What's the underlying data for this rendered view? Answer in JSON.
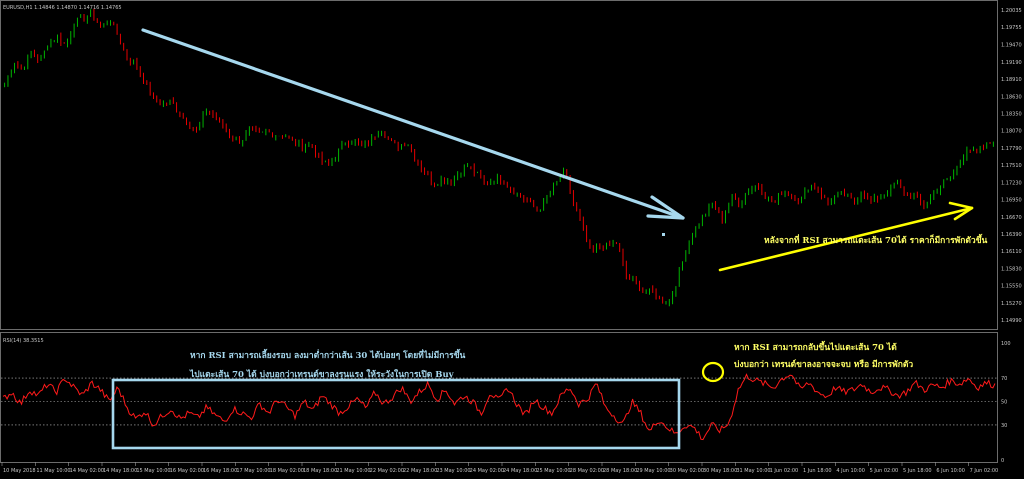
{
  "main_pane": {
    "header": "EURUSD,H1  1.14846 1.14870 1.14716 1.14765",
    "price_labels": [
      "1.20035",
      "1.19755",
      "1.19470",
      "1.19190",
      "1.18910",
      "1.18630",
      "1.18350",
      "1.18070",
      "1.17790",
      "1.17510",
      "1.17230",
      "1.16950",
      "1.16670",
      "1.16390",
      "1.16110",
      "1.15830",
      "1.15550",
      "1.15270",
      "1.14990"
    ]
  },
  "rsi_pane": {
    "header": "RSI(14) 38.3515",
    "level_labels": [
      "100",
      "70",
      "50",
      "30",
      "0"
    ]
  },
  "time_axis": {
    "labels": [
      "10 May 2018",
      "11 May 10:00",
      "14 May 02:00",
      "14 May 18:00",
      "15 May 10:00",
      "16 May 02:00",
      "16 May 18:00",
      "17 May 10:00",
      "18 May 02:00",
      "18 May 18:00",
      "21 May 10:00",
      "22 May 02:00",
      "22 May 18:00",
      "23 May 10:00",
      "24 May 02:00",
      "24 May 18:00",
      "25 May 10:00",
      "28 May 02:00",
      "28 May 18:00",
      "29 May 10:00",
      "30 May 02:00",
      "30 May 18:00",
      "31 May 10:00",
      "1 Jun 02:00",
      "1 Jun 18:00",
      "4 Jun 10:00",
      "5 Jun 02:00",
      "5 Jun 18:00",
      "6 Jun 10:00",
      "7 Jun 02:00"
    ]
  },
  "annotations": {
    "uptrend_note": "หลังจากที่ RSI สามารถแตะเส้น 70ได้ ราคาก็มีการพักตัวขึ้น",
    "rsi_box_line1": "หาก RSI สามารถเลี้ยงรอบ ลงมาต่ำกว่าเส้น 30 ได้บ่อยๆ โดยที่ไม่มีการขึ้น",
    "rsi_box_line2": "ไปแตะเส้น 70 ได้ บ่งบอกว่าเทรนด์ขาลงรุนแรง ให้ระวังในการเปิด Buy",
    "rsi_right_line1": "หาก RSI สามารถกลับขึ้นไปแตะเส้น 70 ได้",
    "rsi_right_line2": "บ่งบอกว่า เทรนด์ขาลงอาจจะจบ หรือ มีการพักตัว"
  },
  "colors": {
    "background": "#000000",
    "bull_candle": "#00c800",
    "bear_candle": "#ff0000",
    "rsi_line": "#ff1a1a",
    "down_arrow": "#a6d8ee",
    "up_arrow": "#ffff00",
    "box": "#a6d8ee",
    "circle": "#ffff00",
    "text_cyan": "#a6d8ee",
    "text_yellow": "#ffff66"
  },
  "chart_data": {
    "type": "candlestick",
    "symbol": "EURUSD",
    "timeframe": "H1",
    "ylim": [
      1.1499,
      1.20035
    ],
    "close_path": [
      1.188,
      1.192,
      1.1905,
      1.1935,
      1.192,
      1.195,
      1.196,
      1.1945,
      1.1985,
      1.199,
      1.1998,
      1.1975,
      1.199,
      1.196,
      1.1925,
      1.1915,
      1.1885,
      1.186,
      1.185,
      1.1855,
      1.1835,
      1.182,
      1.1805,
      1.184,
      1.183,
      1.1815,
      1.1795,
      1.179,
      1.181,
      1.18,
      1.1805,
      1.18,
      1.18,
      1.179,
      1.178,
      1.1785,
      1.176,
      1.175,
      1.177,
      1.179,
      1.179,
      1.178,
      1.1795,
      1.181,
      1.179,
      1.178,
      1.179,
      1.176,
      1.174,
      1.172,
      1.173,
      1.1725,
      1.174,
      1.175,
      1.1735,
      1.172,
      1.173,
      1.1725,
      1.171,
      1.17,
      1.169,
      1.1675,
      1.17,
      1.172,
      1.174,
      1.169,
      1.165,
      1.161,
      1.162,
      1.162,
      1.1625,
      1.157,
      1.156,
      1.1545,
      1.1545,
      1.153,
      1.153,
      1.157,
      1.162,
      1.165,
      1.167,
      1.169,
      1.166,
      1.17,
      1.169,
      1.171,
      1.172,
      1.17,
      1.169,
      1.171,
      1.17,
      1.1695,
      1.172,
      1.171,
      1.169,
      1.17,
      1.1705,
      1.169,
      1.171,
      1.169,
      1.17,
      1.171,
      1.1725,
      1.17,
      1.17,
      1.1685,
      1.17,
      1.172,
      1.173,
      1.175,
      1.178,
      1.177,
      1.178,
      1.179
    ],
    "rsi_levels": [
      30,
      50,
      70
    ],
    "rsi_ylim": [
      0,
      100
    ],
    "rsi_path": [
      52,
      58,
      48,
      60,
      55,
      65,
      58,
      70,
      62,
      55,
      66,
      60,
      50,
      62,
      45,
      35,
      42,
      30,
      38,
      44,
      35,
      40,
      36,
      45,
      38,
      33,
      44,
      40,
      36,
      48,
      40,
      52,
      45,
      38,
      50,
      42,
      55,
      48,
      40,
      46,
      52,
      44,
      58,
      48,
      54,
      62,
      50,
      58,
      65,
      52,
      60,
      48,
      55,
      50,
      40,
      58,
      50,
      62,
      48,
      38,
      52,
      45,
      40,
      55,
      62,
      48,
      52,
      66,
      45,
      38,
      30,
      50,
      40,
      24,
      35,
      28,
      22,
      30,
      28,
      18,
      30,
      25,
      32,
      60,
      72,
      68,
      65,
      62,
      70,
      74,
      60,
      66,
      58,
      54,
      62,
      58,
      60,
      65,
      58,
      62,
      60,
      55,
      58,
      66,
      60,
      64,
      62,
      68,
      65,
      70,
      62,
      66,
      64
    ]
  }
}
